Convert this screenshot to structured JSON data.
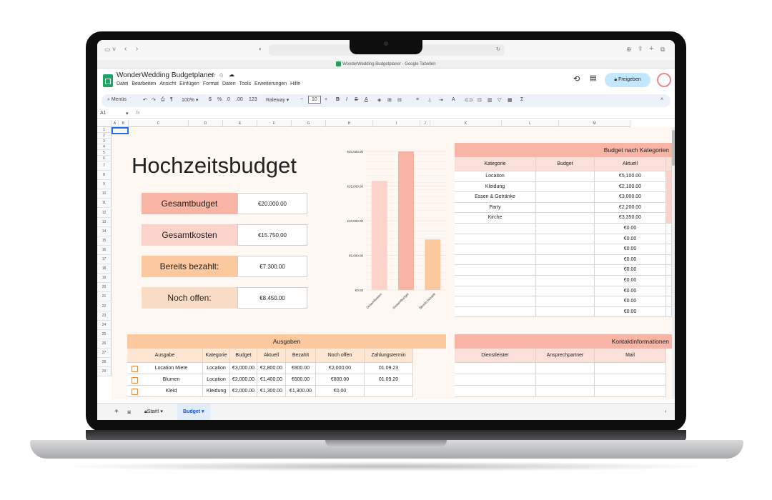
{
  "browser": {
    "tab_title": "WonderWedding Budgetplaner - Google Tabellen"
  },
  "app": {
    "doc_title": "WonderWedding Budgetplaner",
    "menu": [
      "Datei",
      "Bearbeiten",
      "Ansicht",
      "Einfügen",
      "Format",
      "Daten",
      "Tools",
      "Erweiterungen",
      "Hilfe"
    ],
    "share_label": "Freigeben",
    "menus_search": "Menüs",
    "zoom": "100%",
    "font": "Raleway",
    "font_size": "10",
    "cell_ref": "A1",
    "fx": "fx"
  },
  "columns": [
    "A",
    "B",
    "C",
    "D",
    "E",
    "F",
    "G",
    "H",
    "I",
    "J",
    "K",
    "L",
    "M"
  ],
  "rows": [
    "1",
    "2",
    "3",
    "4",
    "5",
    "6",
    "7",
    "8",
    "9",
    "10",
    "11",
    "12",
    "13",
    "14",
    "15",
    "16",
    "17",
    "18",
    "19",
    "20",
    "21",
    "22",
    "23",
    "24",
    "25",
    "26",
    "27",
    "28",
    "29"
  ],
  "summary": {
    "title": "Hochzeitsbudget",
    "items": [
      {
        "label": "Gesamtbudget",
        "value": "€20.000.00",
        "color": "#f8b4a4"
      },
      {
        "label": "Gesamtkosten",
        "value": "€15.750.00",
        "color": "#fbd3cb"
      },
      {
        "label": "Bereits bezahlt:",
        "value": "€7.300.00",
        "color": "#fcc89d"
      },
      {
        "label": "Noch offen:",
        "value": "€8.450.00",
        "color": "#f8dcc5"
      }
    ]
  },
  "chart_data": {
    "type": "bar",
    "categories": [
      "Gesamtkosten",
      "Gesamtbudget",
      "Bereits bezahlt"
    ],
    "values": [
      15750,
      20000,
      7300
    ],
    "colors": [
      "#fbd3cb",
      "#f8b4a4",
      "#fcc89d"
    ],
    "ylim": [
      0,
      20000
    ],
    "yticks": [
      "€0.00",
      "€5,000.00",
      "€10,000.00",
      "€15,000.00",
      "€20,000.00"
    ],
    "grid": true
  },
  "budget_by_category": {
    "title": "Budget nach Kategorien",
    "headers": [
      "Kategorie",
      "Budget",
      "Aktuell"
    ],
    "rows": [
      [
        "Location",
        "",
        "€5,100.00"
      ],
      [
        "Kleidung",
        "",
        "€2,100.00"
      ],
      [
        "Essen & Getränke",
        "",
        "€3,000.00"
      ],
      [
        "Party",
        "",
        "€2,200.00"
      ],
      [
        "Kirche",
        "",
        "€3,350.00"
      ],
      [
        "",
        "",
        "€0.00"
      ],
      [
        "",
        "",
        "€0.00"
      ],
      [
        "",
        "",
        "€0.00"
      ],
      [
        "",
        "",
        "€0.00"
      ],
      [
        "",
        "",
        "€0.00"
      ],
      [
        "",
        "",
        "€0.00"
      ],
      [
        "",
        "",
        "€0.00"
      ],
      [
        "",
        "",
        "€0.00"
      ],
      [
        "",
        "",
        "€0.00"
      ]
    ]
  },
  "expenses": {
    "title": "Ausgaben",
    "headers": [
      "Ausgabe",
      "Kategorie",
      "Budget",
      "Aktuell",
      "Bezahlt",
      "Noch offen",
      "Zahlungstermin"
    ],
    "rows": [
      [
        "Location Miete",
        "Location",
        "€3,000.00",
        "€2,800.00",
        "€800.00",
        "€2,000.00",
        "01.09.23"
      ],
      [
        "Blumen",
        "Location",
        "€2,000.00",
        "€1,400.00",
        "€600.00",
        "€800.00",
        "01.09.20"
      ],
      [
        "Kleid",
        "Kleidung",
        "€2,000.00",
        "€1,300.00",
        "€1,300.00",
        "€0.00",
        ""
      ]
    ]
  },
  "contacts": {
    "title": "Kontaktinformationen",
    "headers": [
      "Dienstleister",
      "Ansprechpartner",
      "Mail"
    ]
  },
  "sheets": {
    "tabs": [
      {
        "label": "Start!"
      },
      {
        "label": "Budget"
      }
    ]
  }
}
